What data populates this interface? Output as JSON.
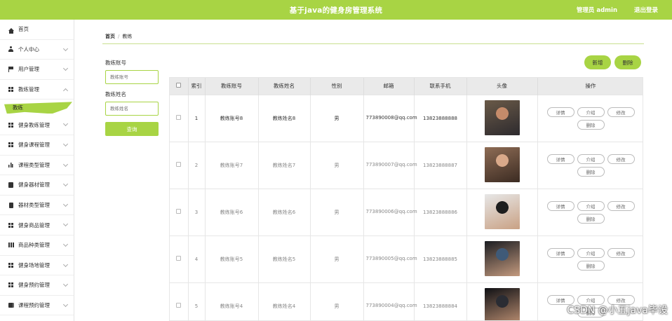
{
  "header": {
    "title": "基于java的健身房管理系统",
    "user_label": "管理员 admin",
    "logout_label": "退出登录",
    "bg_color": "#a8d444"
  },
  "sidebar": {
    "items": [
      {
        "label": "首页",
        "icon": "home-icon",
        "expandable": false
      },
      {
        "label": "个人中心",
        "icon": "user-icon",
        "expandable": true
      },
      {
        "label": "用户管理",
        "icon": "flag-icon",
        "expandable": true
      },
      {
        "label": "教练管理",
        "icon": "grid-icon",
        "expandable": true,
        "expanded": true
      },
      {
        "label": "健身教练管理",
        "icon": "grid-icon",
        "expandable": true
      },
      {
        "label": "健身课程管理",
        "icon": "grid-icon",
        "expandable": true
      },
      {
        "label": "课程类型管理",
        "icon": "bar-chart-icon",
        "expandable": true
      },
      {
        "label": "健身器材管理",
        "icon": "clipboard-icon",
        "expandable": true
      },
      {
        "label": "器材类型管理",
        "icon": "document-icon",
        "expandable": true
      },
      {
        "label": "健身商品管理",
        "icon": "grid-icon",
        "expandable": true
      },
      {
        "label": "商品种类管理",
        "icon": "table-icon",
        "expandable": true
      },
      {
        "label": "健身场地管理",
        "icon": "grid-icon",
        "expandable": true
      },
      {
        "label": "健身预约管理",
        "icon": "grid-icon",
        "expandable": true
      },
      {
        "label": "课程预约管理",
        "icon": "book-icon",
        "expandable": true
      }
    ],
    "active_sub_item": "教练"
  },
  "breadcrumb": {
    "home": "首页",
    "separator": "/",
    "current": "教练"
  },
  "search": {
    "account_label": "教练账号",
    "account_placeholder": "教练账号",
    "name_label": "教练姓名",
    "name_placeholder": "教练姓名",
    "query_button": "查询"
  },
  "actions": {
    "add_label": "新增",
    "delete_label": "删除"
  },
  "table": {
    "columns": [
      "",
      "索引",
      "教练账号",
      "教练姓名",
      "性别",
      "邮箱",
      "联系手机",
      "头像",
      "操作"
    ],
    "rows": [
      {
        "index": "1",
        "account": "教练账号8",
        "name": "教练姓名8",
        "gender": "男",
        "email": "773890008@qq.com",
        "phone": "13823888888",
        "avatar_colors": [
          "#6a5a48",
          "#c58b6a",
          "#2d2a2e"
        ]
      },
      {
        "index": "2",
        "account": "教练账号7",
        "name": "教练姓名7",
        "gender": "男",
        "email": "773890007@qq.com",
        "phone": "13823888887",
        "avatar_colors": [
          "#8e6c55",
          "#d9a98a",
          "#3b2b22"
        ]
      },
      {
        "index": "3",
        "account": "教练账号6",
        "name": "教练姓名6",
        "gender": "男",
        "email": "773890006@qq.com",
        "phone": "13823888886",
        "avatar_colors": [
          "#e7e7e7",
          "#1e1e1e",
          "#c9a184"
        ]
      },
      {
        "index": "4",
        "account": "教练账号5",
        "name": "教练姓名5",
        "gender": "男",
        "email": "773890005@qq.com",
        "phone": "13823888885",
        "avatar_colors": [
          "#1b1d22",
          "#3f5a78",
          "#c49a7e"
        ]
      },
      {
        "index": "5",
        "account": "教练账号4",
        "name": "教练姓名4",
        "gender": "男",
        "email": "773890004@qq.com",
        "phone": "13823888884",
        "avatar_colors": [
          "#0f1014",
          "#2a2c33",
          "#b88c70"
        ]
      }
    ],
    "op_labels": {
      "detail": "详情",
      "intro": "介绍",
      "edit": "修改",
      "delete": "删除"
    }
  },
  "watermark": "CSDN @小五java毕设"
}
